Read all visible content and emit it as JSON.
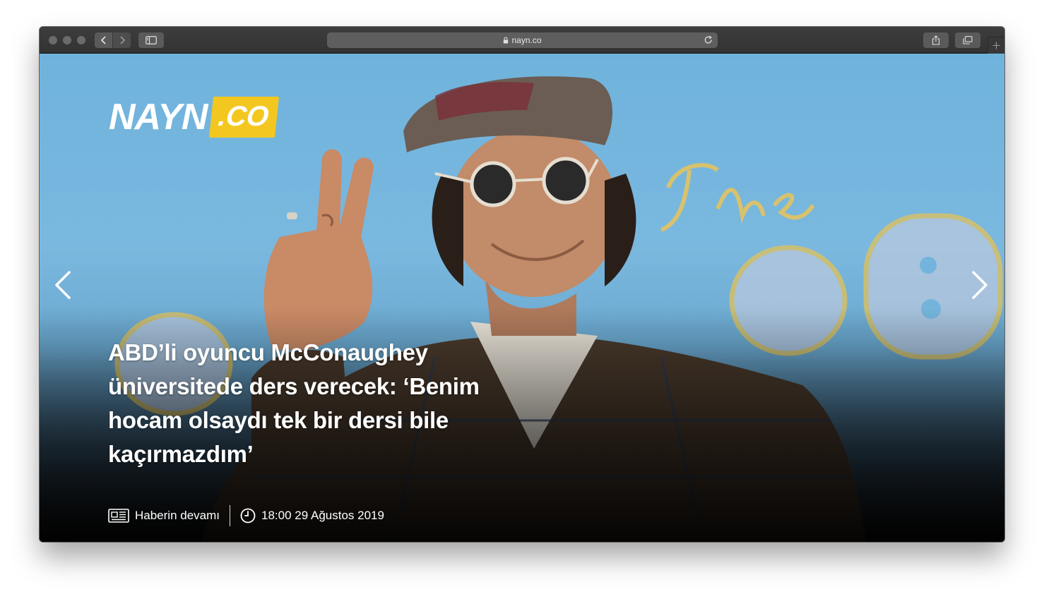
{
  "browser": {
    "url": "nayn.co"
  },
  "site": {
    "logo_main": "NAYN",
    "logo_suffix": ".CO",
    "logo_accent_color": "#f4c720"
  },
  "slide": {
    "headline_lines": [
      "ABD’li oyuncu McConaughey",
      "üniversitede ders verecek: ‘Benim",
      "hocam olsaydı tek bir dersi bile",
      "kaçırmazdım’"
    ],
    "read_more_label": "Haberin devamı",
    "timestamp": "18:00 29 Ağustos 2019"
  },
  "icons": {
    "prev": "chevron-left-icon",
    "next": "chevron-right-icon",
    "news": "newspaper-icon",
    "clock": "clock-icon"
  }
}
